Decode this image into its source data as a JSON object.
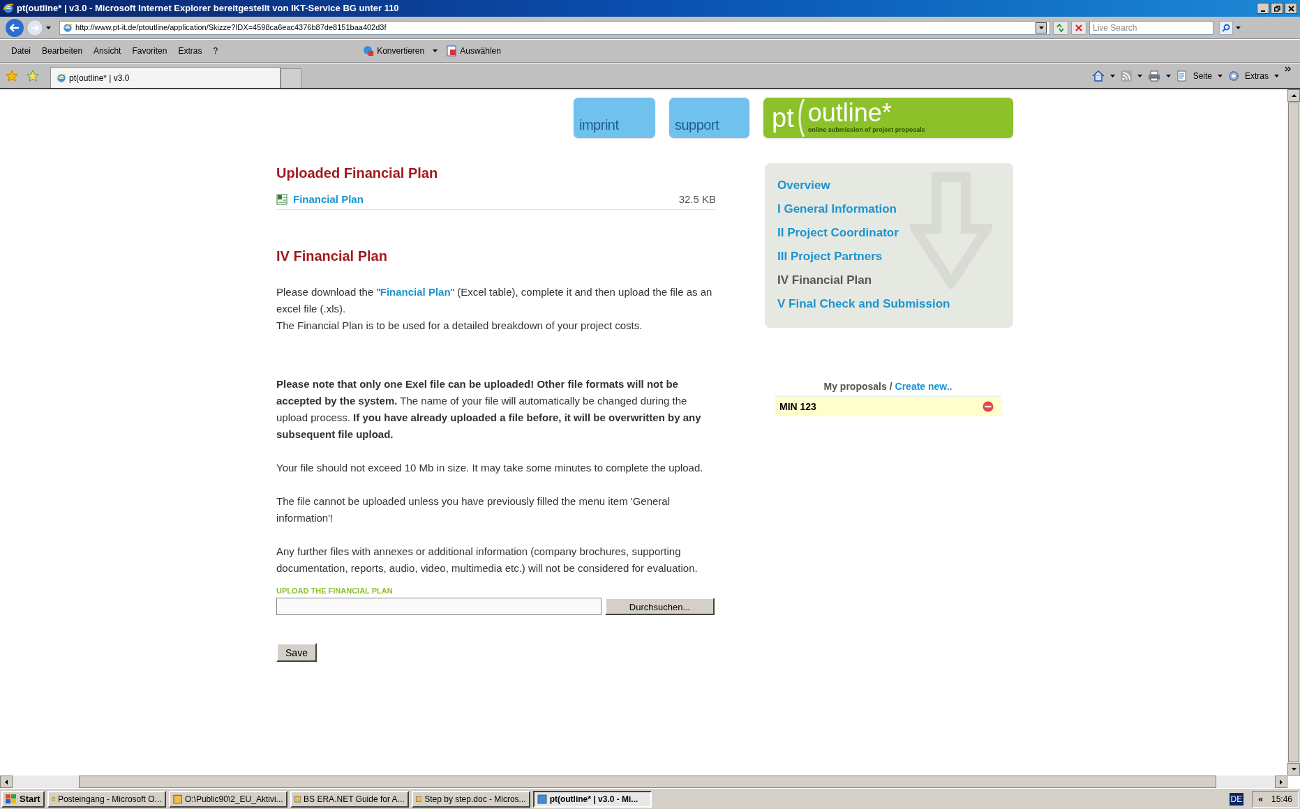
{
  "window": {
    "title": "pt(outline* | v3.0 - Microsoft Internet Explorer bereitgestellt von IKT-Service BG unter 110"
  },
  "address_bar": {
    "url": "http://www.pt-it.de/ptoutline/application/Skizze?IDX=4598ca6eac4376b87de8151baa402d3f",
    "search_placeholder": "Live Search"
  },
  "menu": [
    "Datei",
    "Bearbeiten",
    "Ansicht",
    "Favoriten",
    "Extras",
    "?"
  ],
  "toolbar": [
    "Konvertieren",
    "Auswählen"
  ],
  "tabs": [
    {
      "label": "pt(outline* | v3.0",
      "selected": true
    }
  ],
  "command_bar": [
    "Seite",
    "Extras"
  ],
  "header": {
    "links": [
      "imprint",
      "support"
    ],
    "logo": {
      "main": "pt",
      "name": "outline*",
      "tagline": "online submission of project proposals"
    }
  },
  "uploaded": {
    "heading": "Uploaded Financial Plan",
    "file": {
      "name": "Financial Plan",
      "size": "32.5 KB"
    }
  },
  "section": {
    "heading": "IV Financial Plan",
    "intro": {
      "before": "Please download the \"",
      "link": "Financial Plan",
      "after": "\" (Excel table), complete it and then upload the file as an excel file (.xls)."
    },
    "paragraphs": [
      "The Financial Plan is to be used for a detailed breakdown of your project costs.",
      "**Please  note that  only  one  Exel file can be uploaded! Other file formats will not be accepted by the  system.** The  name  of your file will automatically be changed during the upload process. **If you have already uploaded a file before, it will be overwritten by any subsequent file upload.**",
      "Your file should not exceed 10 Mb in size. It may take some minutes to complete the upload.",
      "The  file  cannot be uploaded unless you have previously filled the menu item 'General information'!",
      "Any  further files with annexes or additional information (company brochures, supporting documentation, reports, audio, video, multimedia etc.) will not be considered for evaluation."
    ],
    "upload_label": "UPLOAD THE FINANCIAL PLAN",
    "browse_button": "Durchsuchen...",
    "save_button": "Save"
  },
  "nav": [
    {
      "label": "Overview",
      "selected": false
    },
    {
      "label": "I General Information",
      "selected": false
    },
    {
      "label": "II Project Coordinator",
      "selected": false
    },
    {
      "label": "III Project Partners",
      "selected": false
    },
    {
      "label": "IV Financial Plan",
      "selected": true
    },
    {
      "label": "V Final Check and Submission",
      "selected": false
    }
  ],
  "proposals": {
    "label": "My proposals /",
    "create_link": "Create new..",
    "items": [
      {
        "name": "MIN 123"
      }
    ]
  },
  "taskbar": {
    "start": "Start",
    "items": [
      {
        "label": "Posteingang - Microsoft O...",
        "active": false
      },
      {
        "label": "O:\\Public90\\2_EU_Aktivi...",
        "active": false
      },
      {
        "label": "BS ERA.NET Guide for A...",
        "active": false
      },
      {
        "label": "Step by step.doc - Micros...",
        "active": false
      },
      {
        "label": "pt(outline* | v3.0 - Mi...",
        "active": true
      }
    ],
    "language": "DE",
    "chevron": "«",
    "clock": "15:46"
  }
}
